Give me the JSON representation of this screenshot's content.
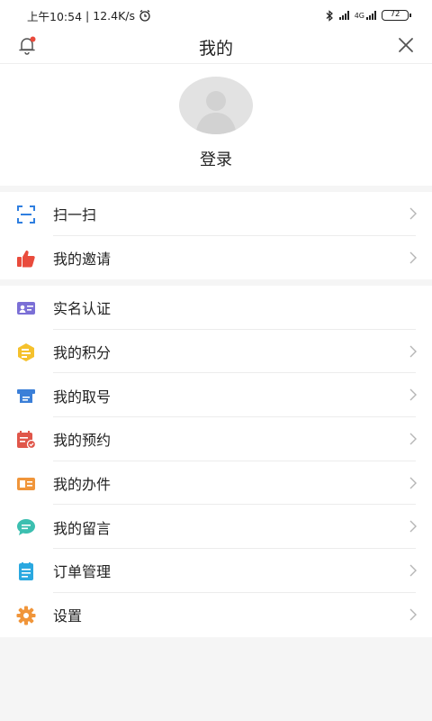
{
  "status_bar": {
    "time": "上午10:54",
    "separator": "|",
    "speed": "12.4K/s",
    "network_label": "4G",
    "battery": "72"
  },
  "header": {
    "title": "我的"
  },
  "profile": {
    "login_label": "登录"
  },
  "menu_group_1": [
    {
      "label": "扫一扫",
      "icon": "scan-icon",
      "color": "#2f7fe0",
      "chevron": true
    },
    {
      "label": "我的邀请",
      "icon": "thumbs-up-icon",
      "color": "#e94b3c",
      "chevron": true
    }
  ],
  "menu_group_2": [
    {
      "label": "实名认证",
      "icon": "id-card-icon",
      "color": "#7b6fd6",
      "chevron": false
    },
    {
      "label": "我的积分",
      "icon": "points-icon",
      "color": "#f5c12c",
      "chevron": true
    },
    {
      "label": "我的取号",
      "icon": "ticket-icon",
      "color": "#3b7fd8",
      "chevron": true
    },
    {
      "label": "我的预约",
      "icon": "calendar-icon",
      "color": "#e0564a",
      "chevron": true
    },
    {
      "label": "我的办件",
      "icon": "document-icon",
      "color": "#f0953a",
      "chevron": true
    },
    {
      "label": "我的留言",
      "icon": "message-icon",
      "color": "#3cbfb0",
      "chevron": true
    },
    {
      "label": "订单管理",
      "icon": "order-list-icon",
      "color": "#2aa8e0",
      "chevron": true
    },
    {
      "label": "设置",
      "icon": "gear-icon",
      "color": "#f0953a",
      "chevron": true
    }
  ]
}
